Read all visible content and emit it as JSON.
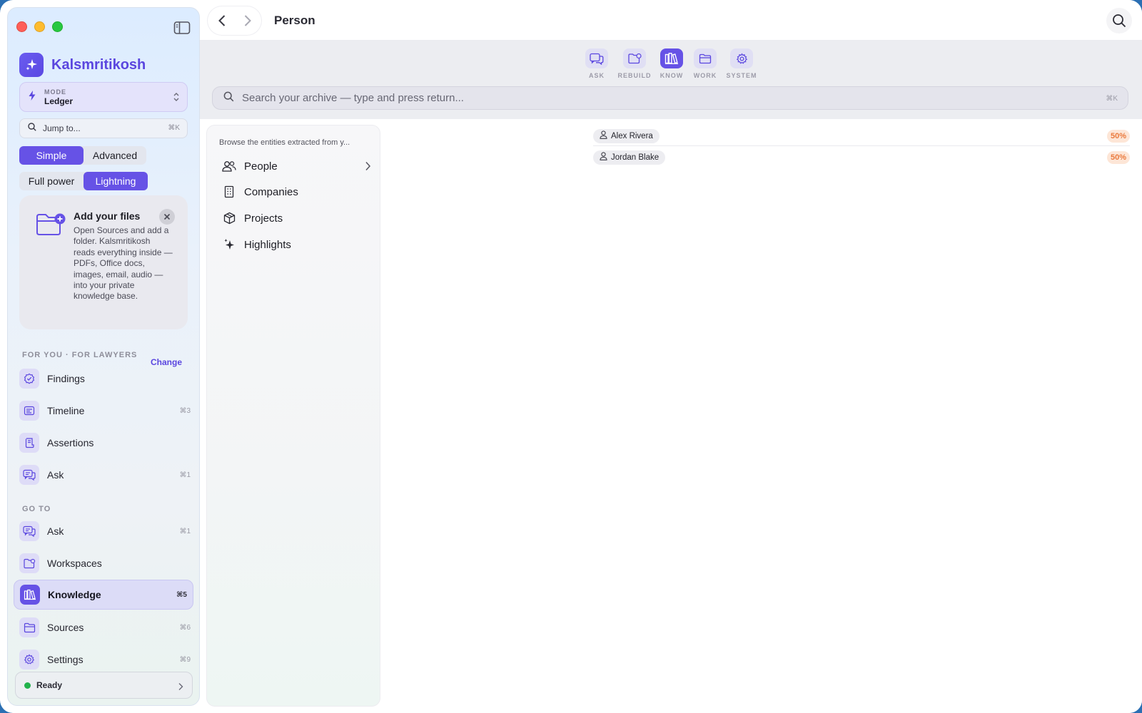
{
  "window": {
    "traffic_lights": [
      "close",
      "minimize",
      "zoom"
    ]
  },
  "sidebar": {
    "brand": "Kalsmritikosh",
    "mode": {
      "label": "MODE",
      "value": "Ledger"
    },
    "jump": {
      "placeholder": "Jump to...",
      "shortcut": "⌘K"
    },
    "segment_1": {
      "options": [
        "Simple",
        "Advanced"
      ],
      "selected": "Simple"
    },
    "segment_2": {
      "options": [
        "Full power",
        "Lightning"
      ],
      "selected": "Lightning"
    },
    "callout": {
      "title": "Add your files",
      "body": "Open Sources and add a folder. Kalsmritikosh reads everything inside — PDFs, Office docs, images, email, audio — into your private knowledge base."
    },
    "for_you": {
      "label": "FOR YOU · FOR LAWYERS",
      "change": "Change",
      "items": [
        {
          "label": "Findings",
          "icon": "badge-check-icon",
          "shortcut": ""
        },
        {
          "label": "Timeline",
          "icon": "timeline-icon",
          "shortcut": "⌘3"
        },
        {
          "label": "Assertions",
          "icon": "scroll-icon",
          "shortcut": ""
        },
        {
          "label": "Ask",
          "icon": "chat-icon",
          "shortcut": "⌘1"
        }
      ]
    },
    "goto": {
      "label": "GO TO",
      "items": [
        {
          "label": "Ask",
          "icon": "chat-icon",
          "shortcut": "⌘1"
        },
        {
          "label": "Workspaces",
          "icon": "folder-gear-icon",
          "shortcut": ""
        },
        {
          "label": "Knowledge",
          "icon": "library-icon",
          "shortcut": "⌘5",
          "active": true
        },
        {
          "label": "Sources",
          "icon": "folder-icon",
          "shortcut": "⌘6"
        },
        {
          "label": "Settings",
          "icon": "gear-icon",
          "shortcut": "⌘9"
        }
      ]
    },
    "status": {
      "label": "Ready",
      "color": "#22b24c"
    }
  },
  "topbar": {
    "title": "Person"
  },
  "toolbar": {
    "tools": [
      {
        "label": "ASK",
        "icon": "chat-icon"
      },
      {
        "label": "REBUILD",
        "icon": "folder-gear-icon"
      },
      {
        "label": "KNOW",
        "icon": "library-icon",
        "active": true
      },
      {
        "label": "WORK",
        "icon": "folder-icon"
      },
      {
        "label": "SYSTEM",
        "icon": "gear-icon"
      }
    ],
    "search": {
      "placeholder": "Search your archive — type and press return...",
      "shortcut": "⌘K"
    }
  },
  "browse": {
    "header": "Browse the entities extracted from y...",
    "items": [
      {
        "label": "People",
        "icon": "people-icon"
      },
      {
        "label": "Companies",
        "icon": "building-icon"
      },
      {
        "label": "Projects",
        "icon": "box-icon"
      },
      {
        "label": "Highlights",
        "icon": "sparkle-icon"
      }
    ]
  },
  "entities": [
    {
      "name": "Alex Rivera",
      "score": "50%"
    },
    {
      "name": "Jordan Blake",
      "score": "50%"
    }
  ],
  "colors": {
    "accent": "#6652e6",
    "brand_text": "#5a46df",
    "score_bg": "#fde6d7",
    "score_text": "#ea7a3d"
  }
}
